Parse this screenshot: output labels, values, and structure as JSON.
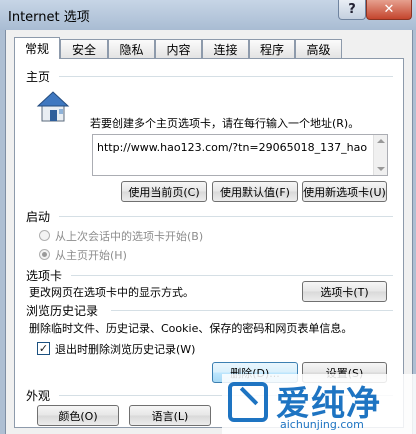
{
  "window": {
    "title": "Internet 选项",
    "help_glyph": "?",
    "close_glyph": "✕"
  },
  "tabs": [
    {
      "label": "常规",
      "active": true
    },
    {
      "label": "安全"
    },
    {
      "label": "隐私"
    },
    {
      "label": "内容"
    },
    {
      "label": "连接"
    },
    {
      "label": "程序"
    },
    {
      "label": "高级"
    }
  ],
  "homepage": {
    "title": "主页",
    "instruction": "若要创建多个主页选项卡，请在每行输入一个地址(R)。",
    "url": "http://www.hao123.com/?tn=29065018_137_hao",
    "buttons": {
      "use_current": "使用当前页(C)",
      "use_default": "使用默认值(F)",
      "use_new_tab": "使用新选项卡(U)"
    }
  },
  "startup": {
    "title": "启动",
    "option_last_session": "从上次会话中的选项卡开始(B)",
    "option_homepage": "从主页开始(H)"
  },
  "tabs_section": {
    "title": "选项卡",
    "description": "更改网页在选项卡中的显示方式。",
    "button": "选项卡(T)"
  },
  "history": {
    "title": "浏览历史记录",
    "description": "删除临时文件、历史记录、Cookie、保存的密码和网页表单信息。",
    "delete_on_exit": "退出时删除浏览历史记录(W)",
    "delete_on_exit_checked": true,
    "check_glyph": "✓",
    "delete_button": "删除(D)...",
    "settings_button": "设置(S)"
  },
  "appearance": {
    "title": "外观",
    "colors_button": "颜色(O)",
    "languages_button": "语言(L)"
  },
  "watermark": {
    "brand": "爱纯净",
    "url": "aichunjing.com"
  },
  "colors": {
    "title_bar": "#b4c6dc",
    "accent": "#1e74c2"
  }
}
